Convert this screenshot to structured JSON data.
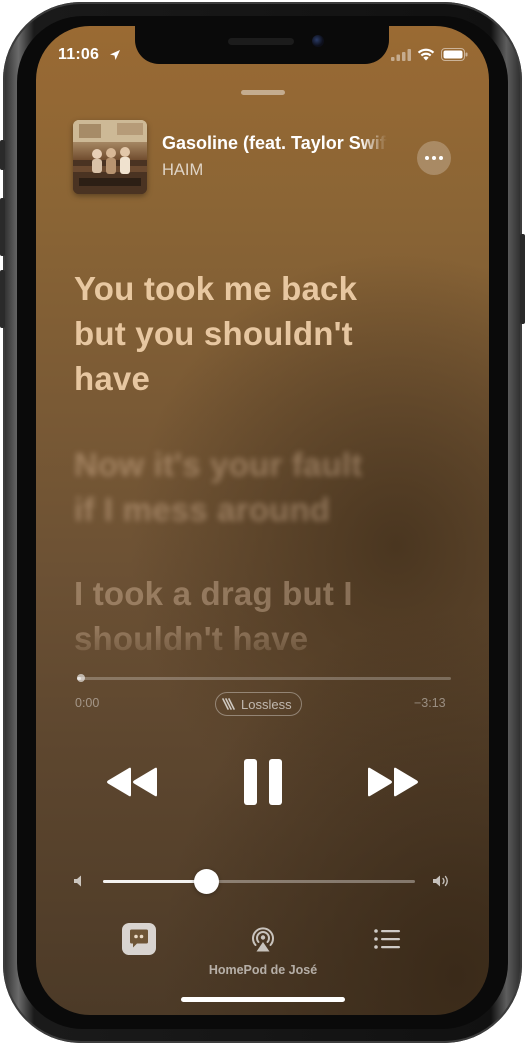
{
  "status_bar": {
    "time": "11:06",
    "location_icon": "location-arrow-icon",
    "signal_icon": "cellular-signal-icon",
    "wifi_icon": "wifi-icon",
    "battery_icon": "battery-icon"
  },
  "now_playing": {
    "title": "Gasoline (feat. Taylor Swift)",
    "artist": "HAIM",
    "more_icon": "ellipsis-icon"
  },
  "lyrics": {
    "active": [
      "You took me back",
      "but you shouldn't",
      "have"
    ],
    "upcoming": [
      "Now it's your fault",
      "if I mess around"
    ],
    "next": [
      "I took a drag but I",
      "shouldn't have"
    ]
  },
  "progress": {
    "elapsed": "0:00",
    "remaining": "−3:13",
    "fraction": 0.01,
    "badge": "Lossless"
  },
  "controls": {
    "rewind_icon": "backward-icon",
    "pause_icon": "pause-icon",
    "forward_icon": "forward-icon"
  },
  "volume": {
    "level": 0.33,
    "min_icon": "speaker-low-icon",
    "max_icon": "speaker-high-icon"
  },
  "bottom_bar": {
    "lyrics_icon": "lyrics-quote-icon",
    "airplay_icon": "airplay-audio-icon",
    "airplay_label": "HomePod de José",
    "queue_icon": "list-icon"
  },
  "colors": {
    "background_top": "#9a6a33",
    "background_bottom": "#4c3a27",
    "lyric_active": "#f6d6b0"
  }
}
